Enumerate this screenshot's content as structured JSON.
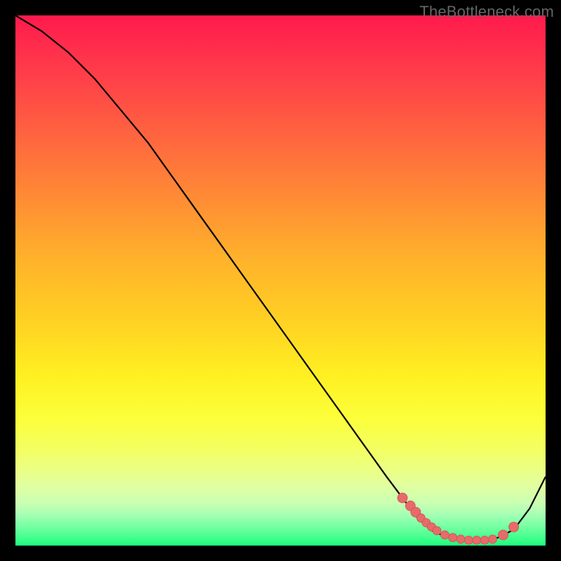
{
  "watermark": "TheBottleneck.com",
  "colors": {
    "page_bg": "#000000",
    "curve": "#000000",
    "dot_fill": "#e86a6a",
    "dot_stroke": "#d24f4f"
  },
  "chart_data": {
    "type": "line",
    "title": "",
    "xlabel": "",
    "ylabel": "",
    "xlim": [
      0,
      100
    ],
    "ylim": [
      0,
      100
    ],
    "grid": false,
    "legend": false,
    "series": [
      {
        "name": "bottleneck-curve",
        "x": [
          0,
          5,
          10,
          15,
          20,
          25,
          30,
          35,
          40,
          45,
          50,
          55,
          60,
          65,
          70,
          73,
          76,
          79,
          82,
          85,
          88,
          91,
          94,
          97,
          100
        ],
        "y": [
          100,
          97,
          93,
          88,
          82,
          76,
          69,
          62,
          55,
          48,
          41,
          34,
          27,
          20,
          13,
          9,
          5,
          2.5,
          1.5,
          1,
          1,
          1.5,
          3,
          7,
          13
        ]
      }
    ],
    "marker_points": {
      "name": "highlight-dots",
      "x": [
        73,
        74.5,
        75.5,
        76.5,
        77.5,
        78.5,
        79.5,
        81,
        82.5,
        84,
        85.5,
        87,
        88.5,
        90,
        92,
        94
      ],
      "y": [
        9,
        7.5,
        6.3,
        5.2,
        4.3,
        3.5,
        2.8,
        2.0,
        1.5,
        1.2,
        1.0,
        1.0,
        1.0,
        1.2,
        2.0,
        3.5
      ]
    }
  }
}
